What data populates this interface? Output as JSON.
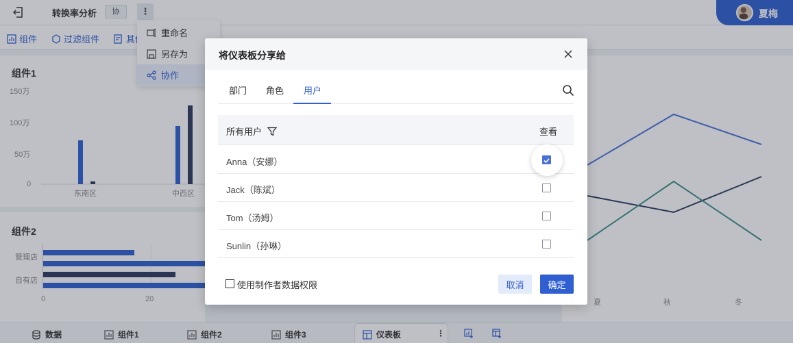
{
  "topbar": {
    "title": "转换率分析",
    "collab_tag": "协",
    "more_label": "⋮",
    "user_name": "夏梅"
  },
  "toolbar": {
    "items": [
      "组件",
      "过滤组件",
      "其他"
    ]
  },
  "dropdown": {
    "items": [
      "重命名",
      "另存为",
      "协作"
    ],
    "active_index": 2
  },
  "panels": {
    "panel1": {
      "title": "组件1",
      "y_ticks": [
        "150万",
        "100万",
        "50万",
        "0"
      ],
      "x_ticks": [
        "东南区",
        "中西区"
      ]
    },
    "panel2": {
      "title": "组件2",
      "y_ticks": [
        "管理店",
        "自有店"
      ],
      "x_ticks": [
        "0",
        "20"
      ]
    },
    "panel3": {
      "x_ticks": [
        "夏",
        "秋",
        "冬"
      ]
    }
  },
  "bottombar": {
    "items": [
      "数据",
      "组件1",
      "组件2",
      "组件3",
      "仪表板"
    ],
    "active_index": 4,
    "more_label": "⋮"
  },
  "modal": {
    "title": "将仪表板分享给",
    "tabs": [
      "部门",
      "角色",
      "用户"
    ],
    "active_tab": 2,
    "header_users": "所有用户",
    "header_view": "查看",
    "rows": [
      {
        "name": "Anna（安娜）",
        "checked": true
      },
      {
        "name": "Jack（陈斌）",
        "checked": false
      },
      {
        "name": "Tom（汤姆）",
        "checked": false
      },
      {
        "name": "Sunlin（孙琳）",
        "checked": false
      }
    ],
    "footer_option": "使用制作者数据权限",
    "cancel_label": "取消",
    "ok_label": "确定"
  },
  "colors": {
    "accent": "#2f5fd0",
    "bar_dark": "#2b3a5e",
    "line_teal": "#3f8f8a"
  }
}
